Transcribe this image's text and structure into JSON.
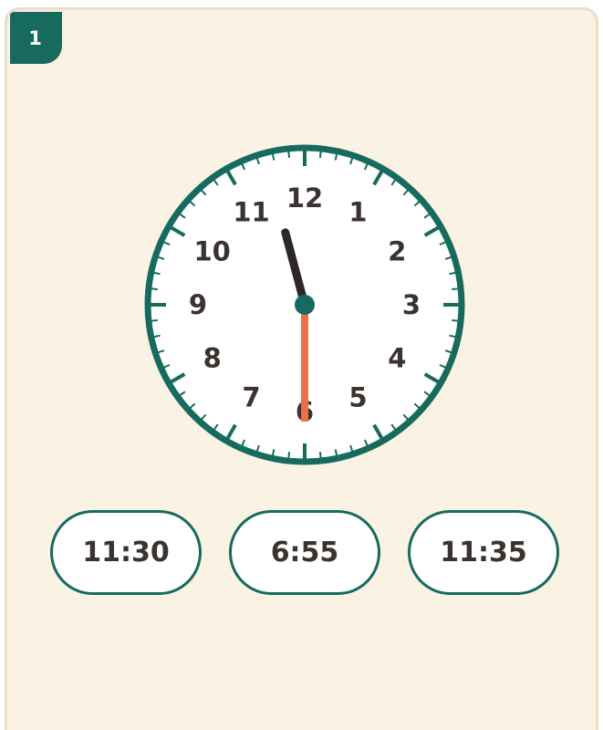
{
  "question": {
    "number": "1"
  },
  "clock": {
    "numbers": [
      "12",
      "1",
      "2",
      "3",
      "4",
      "5",
      "6",
      "7",
      "8",
      "9",
      "10",
      "11"
    ],
    "time": {
      "hour": 11,
      "minute": 30
    },
    "colors": {
      "rim": "#176a5e",
      "face": "#ffffff",
      "hour_hand": "#2d2826",
      "minute_hand": "#e8704b",
      "center": "#176a5e",
      "numbers": "#3a3330"
    }
  },
  "options": [
    {
      "label": "11:30"
    },
    {
      "label": "6:55"
    },
    {
      "label": "11:35"
    }
  ],
  "colors": {
    "card_background": "#faf2e3",
    "card_border": "#eadfc7",
    "accent": "#176a5e",
    "option_background": "#ffffff"
  }
}
